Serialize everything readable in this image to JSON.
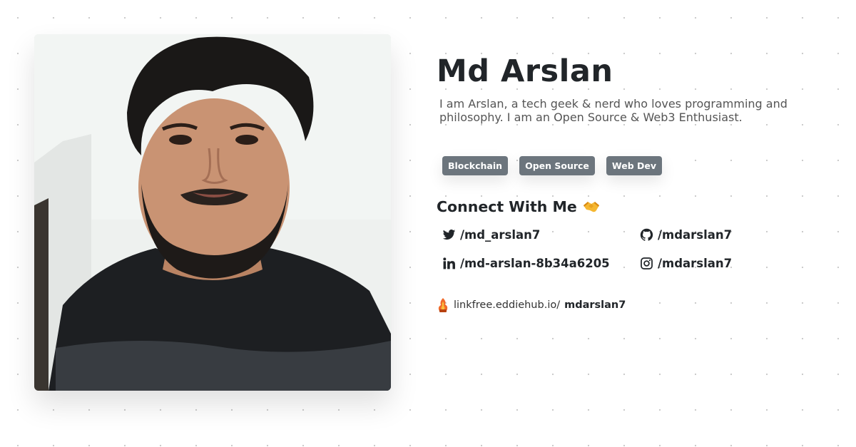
{
  "profile": {
    "name": "Md Arslan",
    "bio": "I am Arslan, a tech geek & nerd who loves programming and philosophy. I am an Open Source & Web3 Enthusiast."
  },
  "tags": [
    "Blockchain",
    "Open Source",
    "Web Dev"
  ],
  "connect": {
    "title": "Connect With Me",
    "emoji_icon": "handshake-icon",
    "links": [
      {
        "icon": "twitter-icon",
        "label": "/md_arslan7"
      },
      {
        "icon": "github-icon",
        "label": "/mdarslan7"
      },
      {
        "icon": "linkedin-icon",
        "label": "/md-arslan-8b34a6205"
      },
      {
        "icon": "instagram-icon",
        "label": "/mdarslan7"
      }
    ]
  },
  "linkfree": {
    "icon": "linkfree-logo-icon",
    "prefix": "linkfree.eddiehub.io/",
    "username": "mdarslan7"
  },
  "colors": {
    "tag_bg": "#6c757d",
    "text": "#212529",
    "muted": "#555555"
  }
}
